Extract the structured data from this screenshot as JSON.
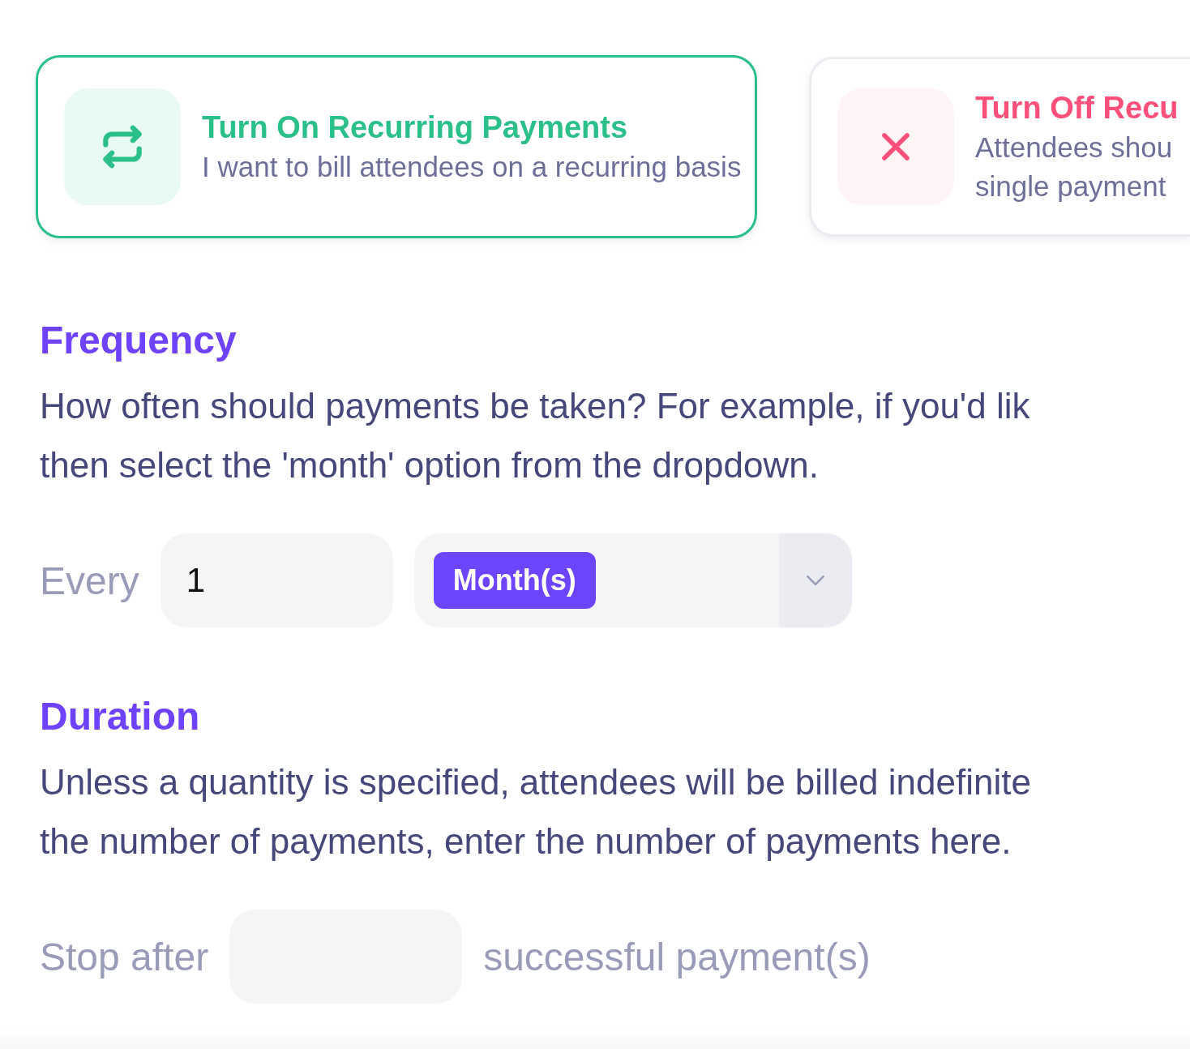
{
  "options": [
    {
      "kind": "on",
      "title": "Turn On Recurring Payments",
      "description": "I want to bill attendees on a recurring basis",
      "selected": true
    },
    {
      "kind": "off",
      "title": "Turn Off Recu",
      "description_lines": [
        "Attendees shou",
        "single payment"
      ],
      "selected": false
    }
  ],
  "frequency": {
    "heading": "Frequency",
    "description_lines": [
      "How often should payments be taken? For example, if you'd lik",
      "then select the 'month' option from the dropdown."
    ],
    "label": "Every",
    "value": "1",
    "unit": "Month(s)"
  },
  "duration": {
    "heading": "Duration",
    "description_lines": [
      "Unless a quantity is specified, attendees will be billed indefinite",
      "the number of payments, enter the number of payments here."
    ],
    "label_before": "Stop after",
    "label_after": "successful payment(s)"
  }
}
